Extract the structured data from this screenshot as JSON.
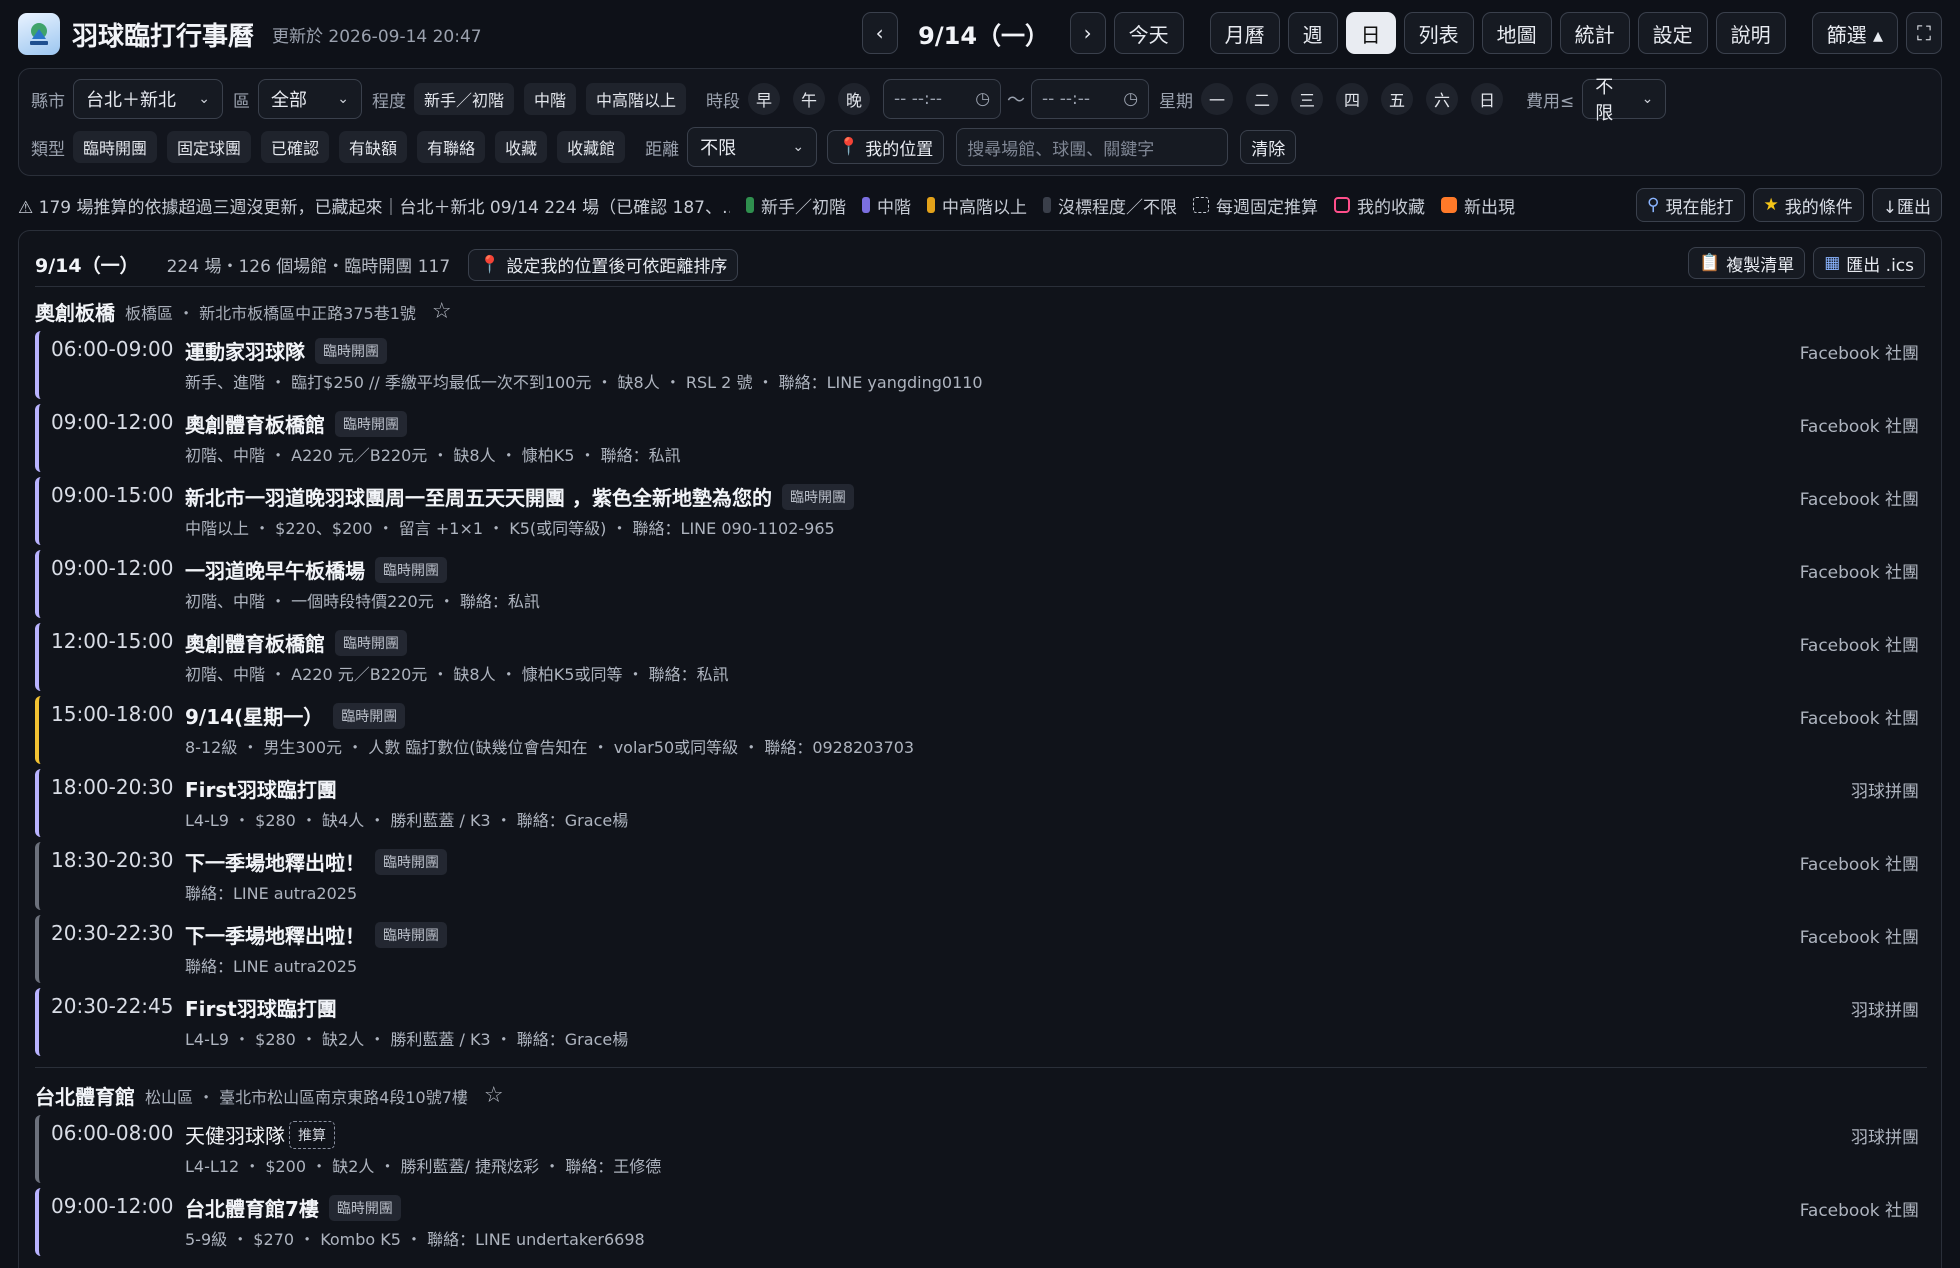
{
  "header": {
    "app_title": "羽球臨打行事曆",
    "updated": "更新於 2026-09-14 20:47",
    "prev": "‹",
    "date": "9/14（一）",
    "next": "›",
    "today": "今天",
    "views": [
      "月曆",
      "週",
      "日",
      "列表",
      "地圖",
      "統計",
      "設定",
      "說明"
    ],
    "active_view": "日",
    "filter_btn": "篩選 ▴",
    "fullscreen": "⛶"
  },
  "filters": {
    "county_label": "縣市",
    "county_value": "台北＋新北",
    "district_label": "區",
    "district_value": "全部",
    "level_label": "程度",
    "levels": [
      "新手／初階",
      "中階",
      "中高階以上"
    ],
    "period_label": "時段",
    "periods": [
      "早",
      "午",
      "晚"
    ],
    "time_from": "-- --:--",
    "time_to": "-- --:--",
    "tilde": "〜",
    "weekday_label": "星期",
    "weekdays": [
      "一",
      "二",
      "三",
      "四",
      "五",
      "六",
      "日"
    ],
    "fee_label": "費用≤",
    "fee_value": "不限",
    "type_label": "類型",
    "types": [
      "臨時開團",
      "固定球團",
      "已確認",
      "有缺額",
      "有聯絡",
      "收藏",
      "收藏館"
    ],
    "distance_label": "距離",
    "distance_value": "不限",
    "my_location": "我的位置",
    "search_placeholder": "搜尋場館、球團、關鍵字",
    "clear": "清除"
  },
  "legend": {
    "notice": "⚠ 179 場推算的依據超過三週沒更新，已藏起來｜台北＋新北 09/14 224 場（已確認 187、…",
    "items": [
      {
        "label": "新手／初階",
        "color": "#2f8f4e"
      },
      {
        "label": "中階",
        "color": "#7b6fe0"
      },
      {
        "label": "中高階以上",
        "color": "#e3a21a"
      },
      {
        "label": "沒標程度／不限",
        "color": "#3a3f4a"
      },
      {
        "label": "每週固定推算",
        "color": "dashed"
      },
      {
        "label": "我的收藏",
        "color": "#ff4f8b"
      },
      {
        "label": "新出現",
        "color": "#ff7a29"
      }
    ],
    "now_playable": "現在能打",
    "my_conditions": "我的條件",
    "export": "↓匯出"
  },
  "panel": {
    "date": "9/14（一）",
    "summary": "224 場・126 個場館・臨時開團 117",
    "location_hint": "設定我的位置後可依距離排序",
    "copy_list": "複製清單",
    "export_ics": "匯出 .ics"
  },
  "venues": [
    {
      "name": "奧創板橋",
      "meta": "板橋區 ・ 新北市板橋區中正路375巷1號",
      "sessions": [
        {
          "time": "06:00-09:00",
          "title": "運動家羽球隊",
          "tag": "臨時開團",
          "detail": "新手、進階 ・ 臨打$250 // 季繳平均最低一次不到100元 ・ 缺8人 ・ RSL 2 號 ・ 聯絡：LINE yangding0110",
          "source": "Facebook 社團",
          "bar": "#b9b3ff"
        },
        {
          "time": "09:00-12:00",
          "title": "奧創體育板橋館",
          "tag": "臨時開團",
          "detail": "初階、中階 ・ A220 元／B220元 ・ 缺8人 ・ 慷柏K5 ・ 聯絡：私訊",
          "source": "Facebook 社團",
          "bar": "#b9b3ff"
        },
        {
          "time": "09:00-15:00",
          "title": "新北市一羽道晚羽球團周一至周五天天開團 ，紫色全新地墊為您的",
          "tag": "臨時開團",
          "detail": "中階以上 ・ $220、$200 ・ 留言 +1×1 ・ K5(或同等級) ・ 聯絡：LINE 090-1102-965",
          "source": "Facebook 社團",
          "bar": "#b9b3ff"
        },
        {
          "time": "09:00-12:00",
          "title": "一羽道晚早午板橋場",
          "tag": "臨時開團",
          "detail": "初階、中階 ・ 一個時段特價220元 ・ 聯絡：私訊",
          "source": "Facebook 社團",
          "bar": "#b9b3ff"
        },
        {
          "time": "12:00-15:00",
          "title": "奧創體育板橋館",
          "tag": "臨時開團",
          "detail": "初階、中階 ・ A220 元／B220元 ・ 缺8人 ・ 慷柏K5或同等 ・ 聯絡：私訊",
          "source": "Facebook 社團",
          "bar": "#b9b3ff"
        },
        {
          "time": "15:00-18:00",
          "title": "9/14(星期一）",
          "tag": "臨時開團",
          "detail": "8-12級 ・ 男生300元 ・ 人數 臨打數位(缺幾位會告知在 ・ volar50或同等級 ・ 聯絡：0928203703",
          "source": "Facebook 社團",
          "bar": "#f2c233"
        },
        {
          "time": "18:00-20:30",
          "title": "First羽球臨打團",
          "tag": "",
          "detail": "L4-L9 ・ $280 ・ 缺4人 ・ 勝利藍蓋 / K3 ・ 聯絡：Grace楊",
          "source": "羽球拼團",
          "bar": "#b9b3ff"
        },
        {
          "time": "18:30-20:30",
          "title": "下一季場地釋出啦！",
          "tag": "臨時開團",
          "detail": "聯絡：LINE autra2025",
          "source": "Facebook 社團",
          "bar": "#6c717c"
        },
        {
          "time": "20:30-22:30",
          "title": "下一季場地釋出啦！",
          "tag": "臨時開團",
          "detail": "聯絡：LINE autra2025",
          "source": "Facebook 社團",
          "bar": "#6c717c"
        },
        {
          "time": "20:30-22:45",
          "title": "First羽球臨打團",
          "tag": "",
          "detail": "L4-L9 ・ $280 ・ 缺2人 ・ 勝利藍蓋 / K3 ・ 聯絡：Grace楊",
          "source": "羽球拼團",
          "bar": "#b9b3ff"
        }
      ]
    },
    {
      "name": "台北體育館",
      "meta": "松山區 ・ 臺北市松山區南京東路4段10號7樓",
      "sessions": [
        {
          "time": "06:00-08:00",
          "title": "天健羽球隊",
          "tag": "推算",
          "detail": "L4-L12 ・ $200 ・ 缺2人 ・ 勝利藍蓋/ 捷飛炫彩 ・ 聯絡：王修德",
          "source": "羽球拼團",
          "bar": "#6c717c"
        },
        {
          "time": "09:00-12:00",
          "title": "台北體育館7樓",
          "tag": "臨時開團",
          "detail": "5-9級 ・ $270 ・ Kombo K5 ・ 聯絡：LINE undertaker6698",
          "source": "Facebook 社團",
          "bar": "#b9b3ff"
        }
      ]
    }
  ]
}
